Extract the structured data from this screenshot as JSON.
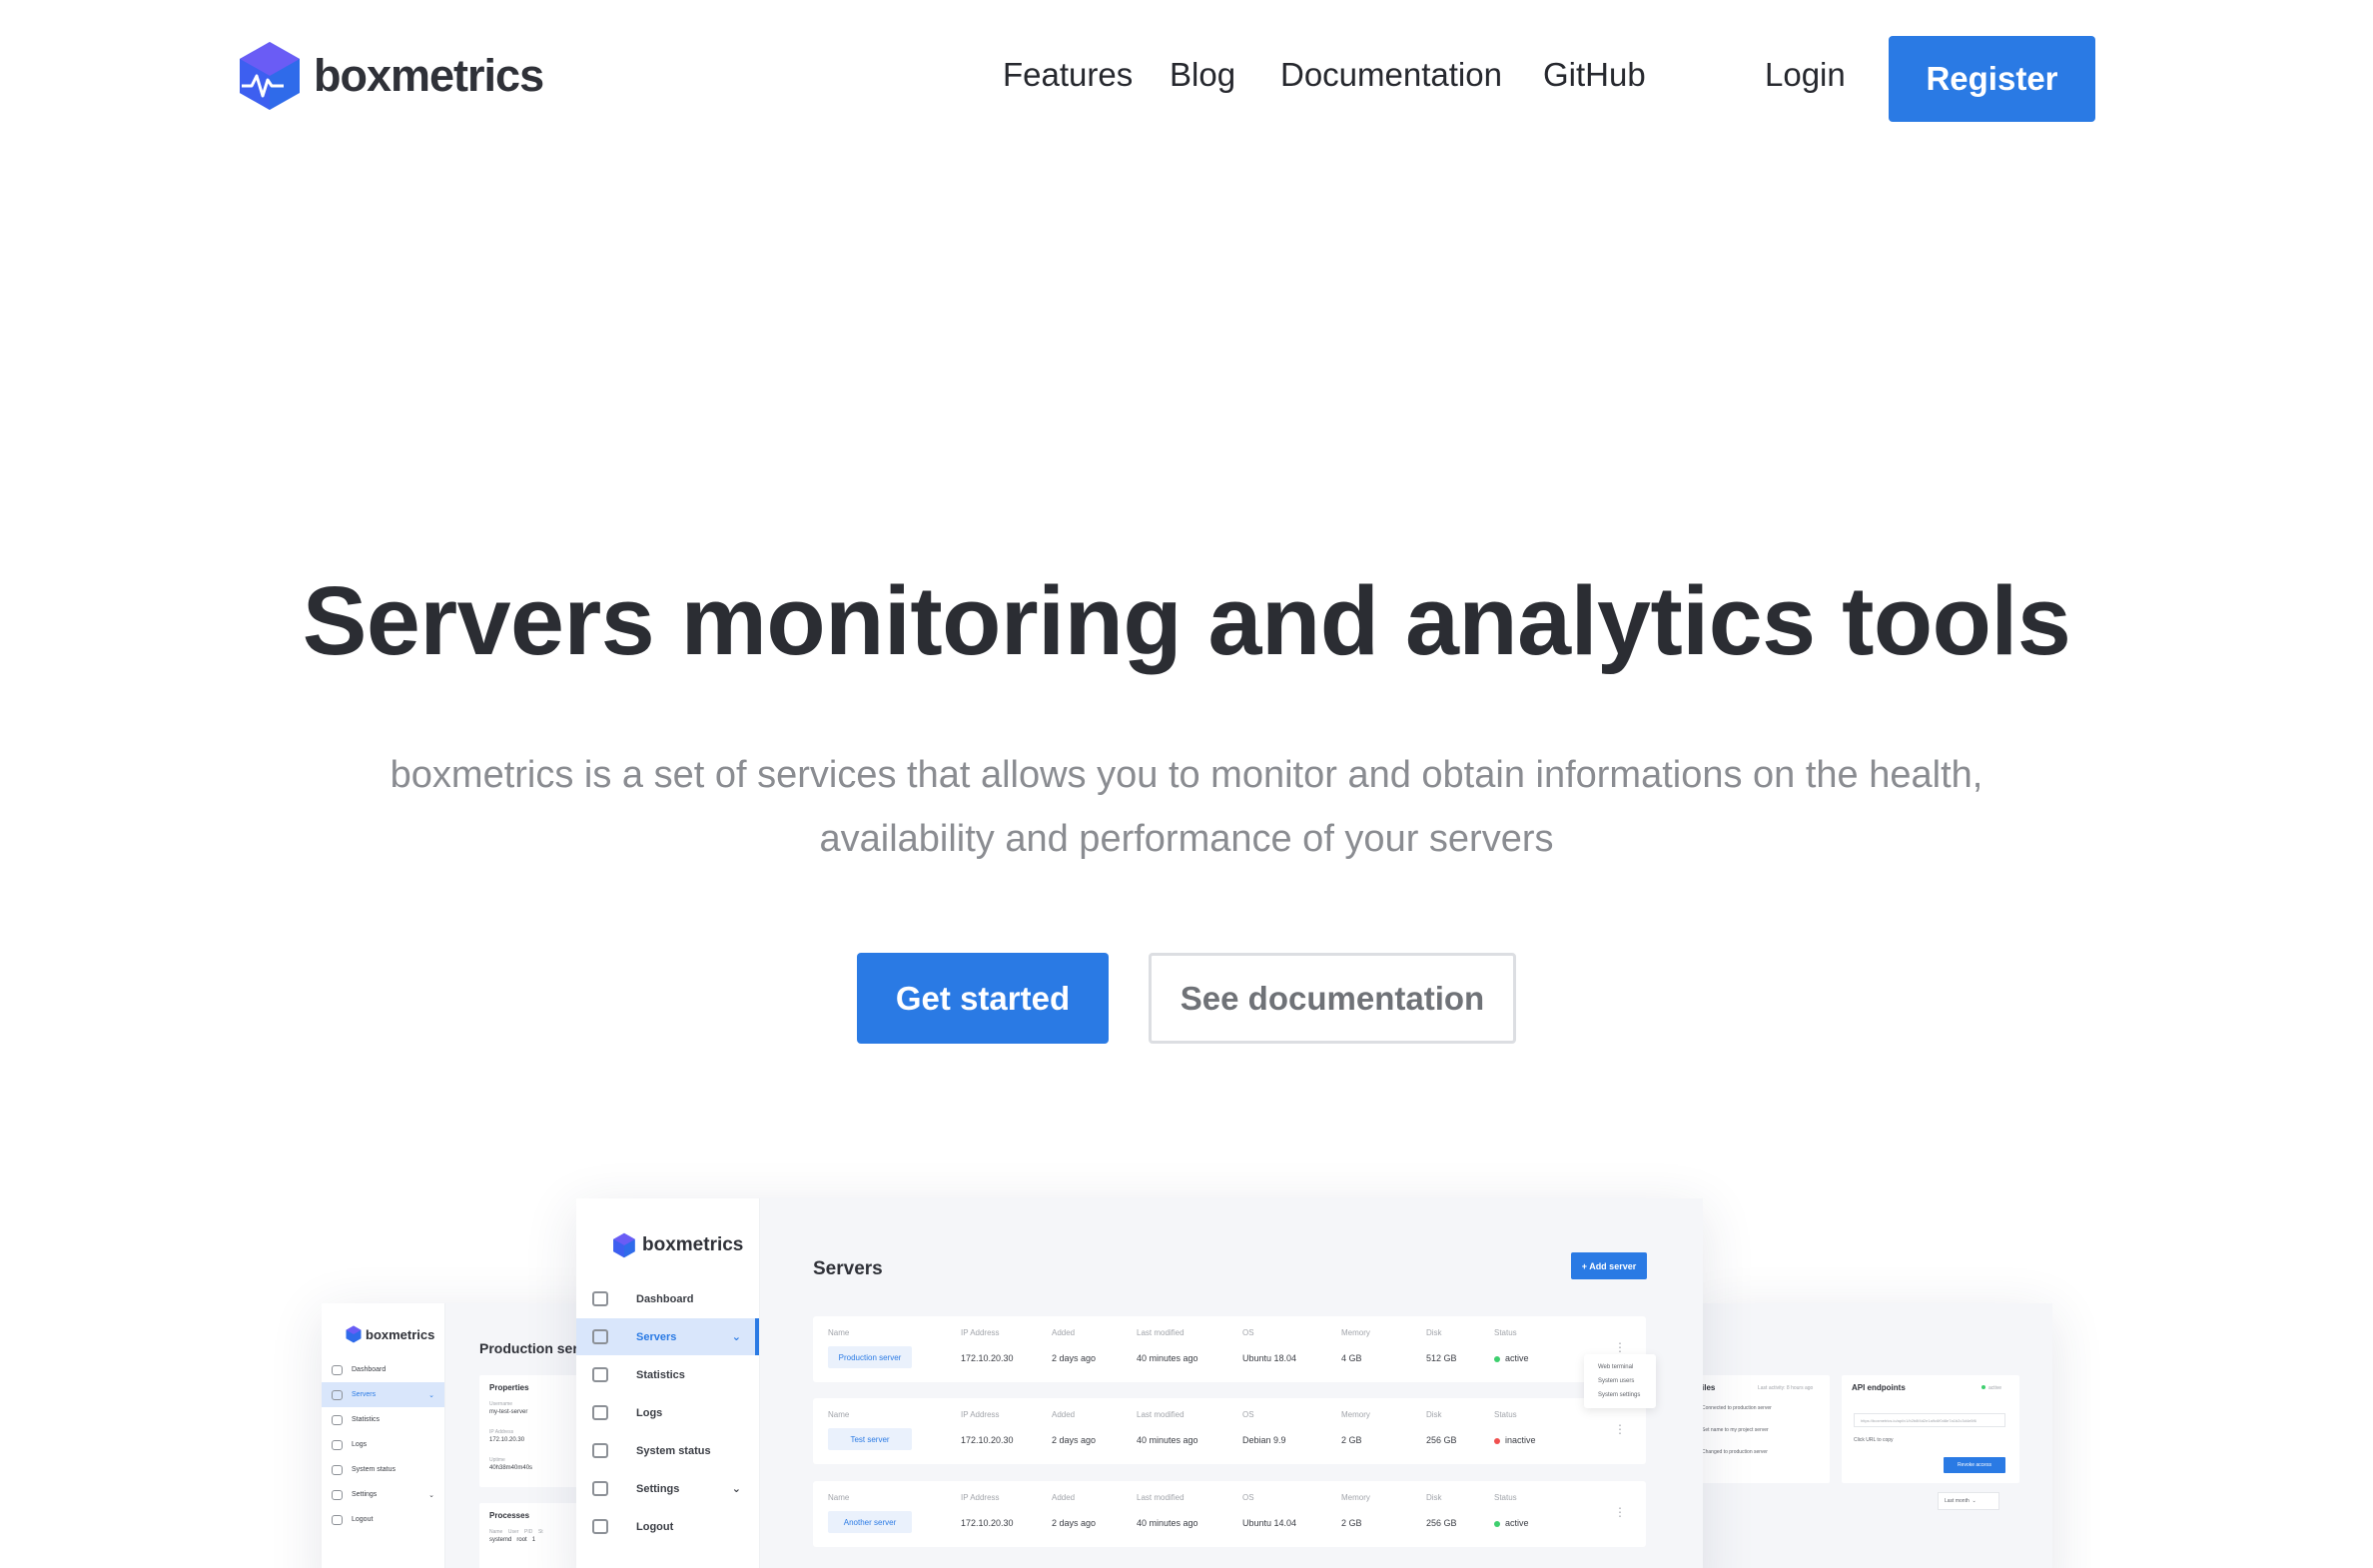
{
  "brand": {
    "name": "boxmetrics",
    "colors": {
      "primary": "#2a7ae4",
      "logo_top": "#5b5ef0",
      "logo_side": "#2f6bea",
      "text_dark": "#2b2d33",
      "text_muted": "#8a8c91",
      "active_green": "#3ecf6e",
      "inactive_red": "#f0504f"
    }
  },
  "nav": {
    "links": [
      "Features",
      "Blog",
      "Documentation",
      "GitHub"
    ],
    "login": "Login",
    "register": "Register"
  },
  "hero": {
    "title": "Servers monitoring and analytics tools",
    "subtitle_line1": "boxmetrics is a set of services that allows you to monitor and obtain informations on the health,",
    "subtitle_line2": "availability and performance of your servers",
    "primary_cta": "Get started",
    "secondary_cta": "See documentation"
  },
  "app_preview": {
    "logo": "boxmetrics",
    "sidebar": [
      {
        "label": "Dashboard",
        "icon": "dashboard-icon"
      },
      {
        "label": "Servers",
        "icon": "servers-icon",
        "active": true,
        "chevron": "⌄"
      },
      {
        "label": "Statistics",
        "icon": "statistics-icon"
      },
      {
        "label": "Logs",
        "icon": "logs-icon"
      },
      {
        "label": "System status",
        "icon": "system-status-icon"
      },
      {
        "label": "Settings",
        "icon": "settings-icon",
        "chevron": "⌄"
      },
      {
        "label": "Logout",
        "icon": "logout-icon"
      }
    ],
    "page_title": "Servers",
    "add_button": "+ Add server",
    "columns": [
      "Name",
      "IP Address",
      "Added",
      "Last modified",
      "OS",
      "Memory",
      "Disk",
      "Status"
    ],
    "servers": [
      {
        "name": "Production server",
        "ip": "172.10.20.30",
        "added": "2 days ago",
        "modified": "40 minutes ago",
        "os": "Ubuntu 18.04",
        "memory": "4 GB",
        "disk": "512 GB",
        "status": "active"
      },
      {
        "name": "Test server",
        "ip": "172.10.20.30",
        "added": "2 days ago",
        "modified": "40 minutes ago",
        "os": "Debian 9.9",
        "memory": "2 GB",
        "disk": "256 GB",
        "status": "inactive"
      },
      {
        "name": "Another server",
        "ip": "172.10.20.30",
        "added": "2 days ago",
        "modified": "40 minutes ago",
        "os": "Ubuntu 14.04",
        "memory": "2 GB",
        "disk": "256 GB",
        "status": "active"
      }
    ],
    "dropdown": [
      "Web terminal",
      "System users",
      "System settings"
    ]
  },
  "left_preview": {
    "logo": "boxmetrics",
    "sidebar": [
      "Dashboard",
      "Servers",
      "Statistics",
      "Logs",
      "System status",
      "Settings",
      "Logout"
    ],
    "title": "Production server",
    "properties_title": "Properties",
    "properties": [
      {
        "label": "Username",
        "value": "my-test-server"
      },
      {
        "label": "IP Address",
        "value": "172.10.20.30"
      },
      {
        "label": "Uptime",
        "value": "40h38m40m40s"
      }
    ],
    "processes_title": "Processes",
    "processes_headers": [
      "Name",
      "User",
      "PID",
      "St"
    ],
    "processes_row": [
      "systemd",
      "root",
      "1",
      ""
    ]
  },
  "right_preview": {
    "files_title": "iles",
    "files_meta": "Last activity: 8 hours ago",
    "files": [
      "Connected to production server",
      "Set name to my project server",
      "Changed to production server"
    ],
    "api_title": "API endpoints",
    "api_status": "active",
    "api_url": "https://boxmetrics.io/api/v1/b2b8f4d2e1a9c6f0d8e7a1b2c3d4e5f6",
    "api_hint": "Click URL to copy",
    "revoke": "Revoke access",
    "range": "Last month"
  }
}
